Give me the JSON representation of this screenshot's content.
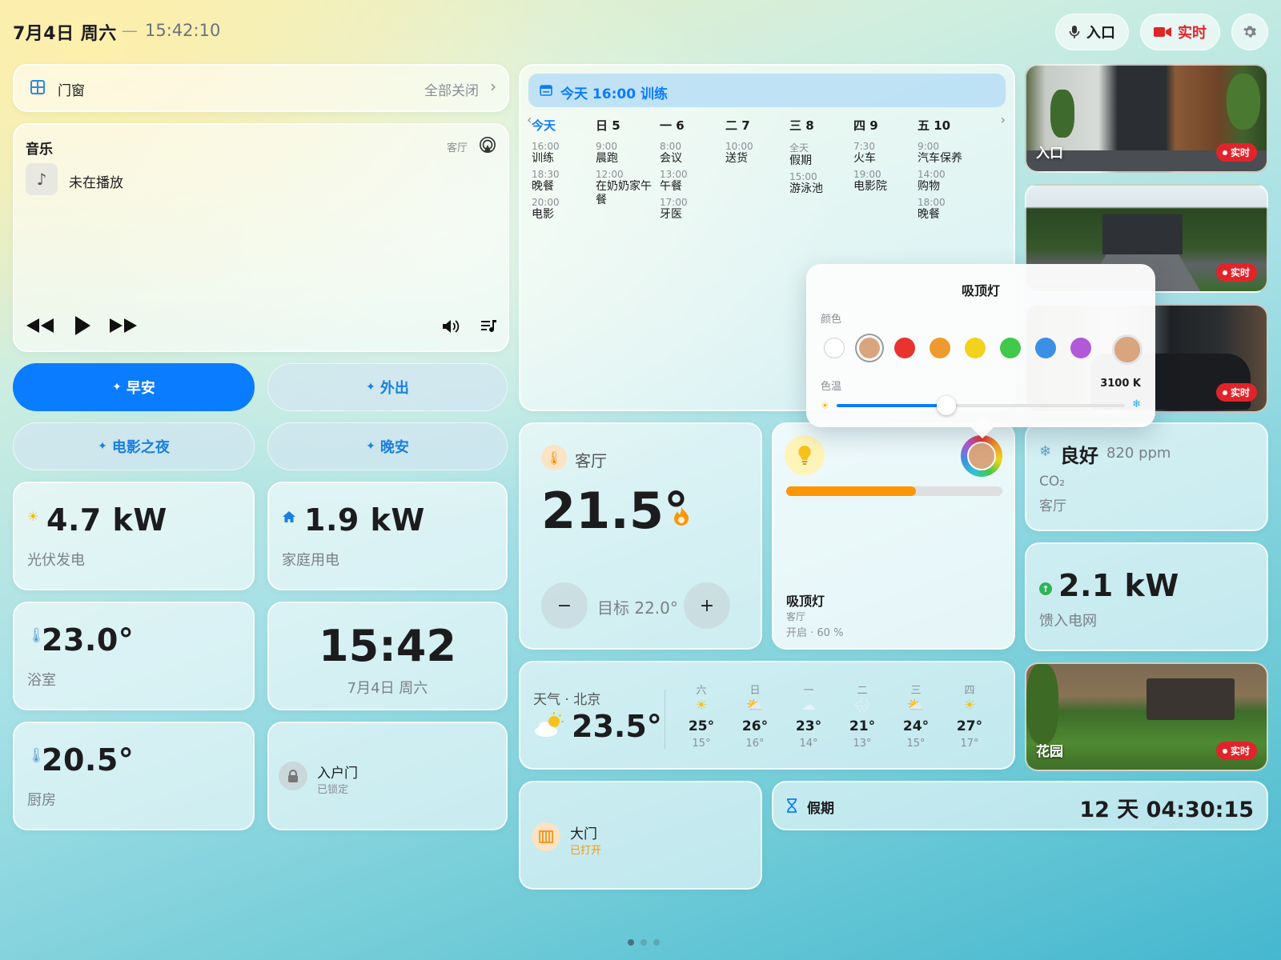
{
  "header": {
    "date": "7月4日 周六",
    "separator": "—",
    "time": "15:42:10",
    "entrance_btn": "入口",
    "live_btn": "实时"
  },
  "doors": {
    "label": "门窗",
    "action": "全部关闭"
  },
  "music": {
    "title": "音乐",
    "room": "客厅",
    "status": "未在播放"
  },
  "scenes": [
    "早安",
    "外出",
    "电影之夜",
    "晚安"
  ],
  "energy": {
    "solar_value": "4.7 kW",
    "solar_label": "光伏发电",
    "home_value": "1.9 kW",
    "home_label": "家庭用电"
  },
  "bathroom": {
    "temp": "23.0°",
    "label": "浴室"
  },
  "clock": {
    "time": "15:42",
    "date": "7月4日 周六"
  },
  "kitchen": {
    "temp": "20.5°",
    "label": "厨房"
  },
  "front_door": {
    "label": "入户门",
    "status": "已锁定"
  },
  "calendar": {
    "banner": "今天 16:00 训练",
    "days": [
      {
        "day": "今天",
        "events": [
          [
            "16:00",
            "训练"
          ],
          [
            "18:30",
            "晚餐"
          ],
          [
            "20:00",
            "电影"
          ]
        ]
      },
      {
        "day": "日 5",
        "events": [
          [
            "9:00",
            "晨跑"
          ],
          [
            "12:00",
            "在奶奶家午餐"
          ]
        ]
      },
      {
        "day": "一 6",
        "events": [
          [
            "8:00",
            "会议"
          ],
          [
            "13:00",
            "午餐"
          ],
          [
            "17:00",
            "牙医"
          ]
        ]
      },
      {
        "day": "二 7",
        "events": [
          [
            "10:00",
            "送货"
          ]
        ]
      },
      {
        "day": "三 8",
        "events": [
          [
            "全天",
            "假期"
          ],
          [
            "15:00",
            "游泳池"
          ]
        ]
      },
      {
        "day": "四 9",
        "events": [
          [
            "7:30",
            "火车"
          ],
          [
            "19:00",
            "电影院"
          ]
        ]
      },
      {
        "day": "五 10",
        "events": [
          [
            "9:00",
            "汽车保养"
          ],
          [
            "14:00",
            "购物"
          ],
          [
            "18:00",
            "晚餐"
          ]
        ]
      }
    ]
  },
  "cameras": [
    {
      "label": "入口",
      "live": "实时"
    },
    {
      "label": "",
      "live": "实时"
    },
    {
      "label": "",
      "live": "实时"
    },
    {
      "label": "花园",
      "live": "实时"
    }
  ],
  "popover": {
    "title": "吸顶灯",
    "color_label": "颜色",
    "temp_label": "色温",
    "temp_value": "3100 K",
    "temp_level": 0.38,
    "colors": [
      "#ffffff",
      "#d9a57e",
      "#e8332e",
      "#ee9a2e",
      "#f2d21e",
      "#42c84a",
      "#3d8fe6",
      "#b05ad8"
    ]
  },
  "thermostat": {
    "room": "客厅",
    "temp": "21.5°",
    "target": "目标 22.0°",
    "minus": "−",
    "plus": "+"
  },
  "light": {
    "name": "吸顶灯",
    "room": "客厅",
    "status": "开启 · 60 %",
    "brightness": 0.6
  },
  "air": {
    "quality": "良好",
    "ppm": "820 ppm",
    "gas": "CO₂",
    "room": "客厅"
  },
  "grid": {
    "value": "2.1 kW",
    "label": "馈入电网"
  },
  "weather": {
    "title": "天气 · 北京",
    "temp": "23.5°",
    "forecast": [
      {
        "day": "六",
        "hi": "25°",
        "lo": "15°",
        "icon": "sun-icon"
      },
      {
        "day": "日",
        "hi": "26°",
        "lo": "16°",
        "icon": "partly-cloudy-icon"
      },
      {
        "day": "一",
        "hi": "23°",
        "lo": "14°",
        "icon": "cloud-icon"
      },
      {
        "day": "二",
        "hi": "21°",
        "lo": "13°",
        "icon": "rain-icon"
      },
      {
        "day": "三",
        "hi": "24°",
        "lo": "15°",
        "icon": "partly-cloudy-icon"
      },
      {
        "day": "四",
        "hi": "27°",
        "lo": "17°",
        "icon": "sun-icon"
      }
    ]
  },
  "gate": {
    "label": "大门",
    "status": "已打开"
  },
  "holiday": {
    "label": "假期",
    "countdown": "12 天 04:30:15"
  },
  "colors": {
    "accent": "#0a7cff",
    "orange": "#ff9500",
    "live": "#e0242a"
  }
}
